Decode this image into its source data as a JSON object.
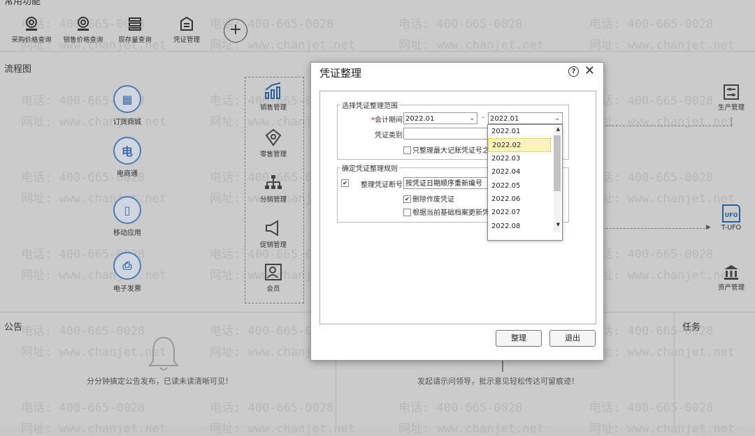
{
  "quick_access": {
    "title": "常用功能",
    "items": [
      {
        "label": "采购价格查询",
        "icon": "price-query-icon"
      },
      {
        "label": "销售价格查询",
        "icon": "price-query-icon"
      },
      {
        "label": "现存量查询",
        "icon": "stock-query-icon"
      },
      {
        "label": "凭证管理",
        "icon": "voucher-icon"
      }
    ],
    "add_symbol": "+"
  },
  "flow": {
    "title": "流程图",
    "left_items": [
      {
        "label": "订货商城",
        "glyph": "▦"
      },
      {
        "label": "电商通",
        "glyph": "电"
      },
      {
        "label": "移动应用",
        "glyph": "▯"
      },
      {
        "label": "电子发票",
        "glyph": "⎙"
      }
    ],
    "mid_items": [
      {
        "label": "销售管理"
      },
      {
        "label": "零售管理"
      },
      {
        "label": "分销管理"
      },
      {
        "label": "促销管理"
      },
      {
        "label": "会员"
      }
    ],
    "right_items": [
      {
        "label": "生产管理"
      },
      {
        "label": "T-UFO",
        "badge": "UFO"
      },
      {
        "label": "资产管理"
      }
    ]
  },
  "notice": {
    "title": "公告",
    "empty_text": "分分钟搞定公告发布，已读未读清晰可见！"
  },
  "approval": {
    "empty_text": "发起请示问领导，批示意见轻松传达可留痕迹！"
  },
  "tasks": {
    "title": "任务"
  },
  "watermark": {
    "phone": "电话: 400-665-0028",
    "site": "网址: www.chanjet.net"
  },
  "dialog": {
    "title": "凭证整理",
    "help": "?",
    "close": "✕",
    "range_group": "选择凭证整理范围",
    "period_label": "会计期间",
    "period_required": "*",
    "period_from": "2022.01",
    "period_to": "2022.01",
    "dash": "-",
    "type_label": "凭证类别",
    "type_value": "",
    "only_max_label": "只整理最大记账凭证号之",
    "rules_group": "确定凭证整理规则",
    "break_label": "整理凭证断号",
    "break_value": "按凭证日期顺序重新编号",
    "delete_void_label": "删除作废凭证",
    "update_archive_label": "根据当前基础档案更新凭",
    "ok_button": "整理",
    "exit_button": "退出",
    "dropdown_options": [
      "2022.01",
      "2022.02",
      "2022.03",
      "2022.04",
      "2022.05",
      "2022.06",
      "2022.07",
      "2022.08"
    ],
    "dropdown_highlight": "2022.02"
  }
}
